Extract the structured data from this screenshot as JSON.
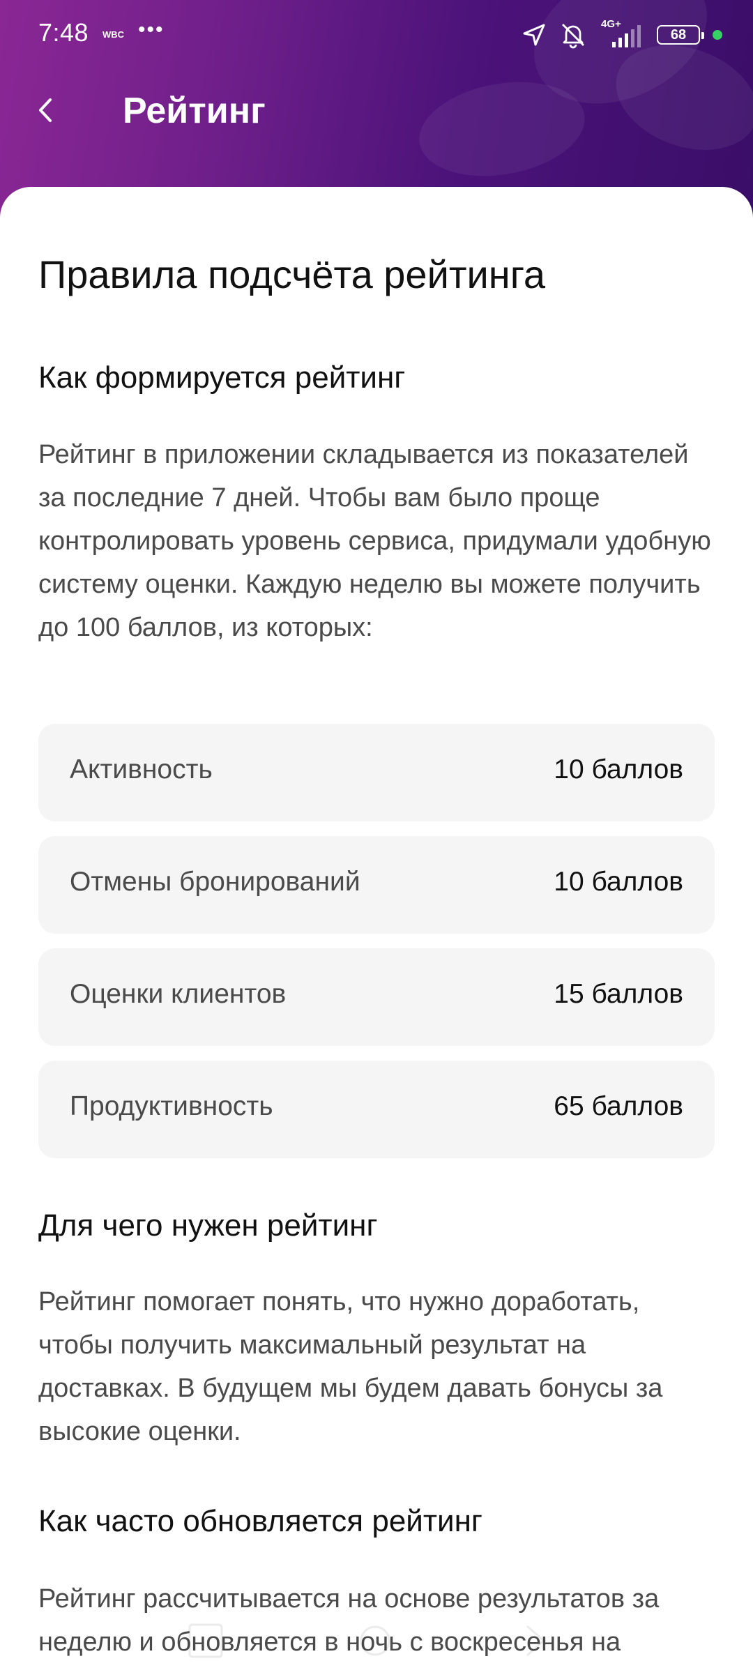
{
  "status_bar": {
    "time": "7:48",
    "carrier": "WBC",
    "more": "•••",
    "network": "4G+",
    "battery": "68",
    "icons": [
      "location-arrow-icon",
      "mute-bell-icon",
      "signal-icon",
      "battery-icon",
      "active-dot-icon"
    ]
  },
  "app_bar": {
    "title": "Рейтинг",
    "back_icon": "chevron-left-icon"
  },
  "content": {
    "title": "Правила подсчёта рейтинга",
    "sections": [
      {
        "heading": "Как формируется рейтинг",
        "text": "Рейтинг в приложении складывается из показателей за последние 7 дней. Чтобы вам было проще контролировать уровень сервиса, придумали удобную систему оценки. Каждую неделю вы можете получить до 100 баллов, из которых:"
      },
      {
        "heading": "Для чего нужен рейтинг",
        "text": "Рейтинг помогает понять, что нужно доработать, чтобы получить максимальный результат на доставках. В будущем мы будем давать бонусы за высокие оценки."
      },
      {
        "heading": "Как часто обновляется рейтинг",
        "text": "Рейтинг рассчитывается на основе результатов за неделю и обновляется в ночь с воскресенья на"
      }
    ],
    "score_items": [
      {
        "label": "Активность",
        "value": "10 баллов"
      },
      {
        "label": "Отмены бронирований",
        "value": "10 баллов"
      },
      {
        "label": "Оценки клиентов",
        "value": "15 баллов"
      },
      {
        "label": "Продуктивность",
        "value": "65 баллов"
      }
    ]
  },
  "colors": {
    "header_gradient_start": "#8a2795",
    "header_gradient_end": "#3a0e68",
    "card_background": "#f5f5f6",
    "body_text": "#4a4a4a",
    "title_text": "#111111",
    "status_dot": "#36d163"
  }
}
